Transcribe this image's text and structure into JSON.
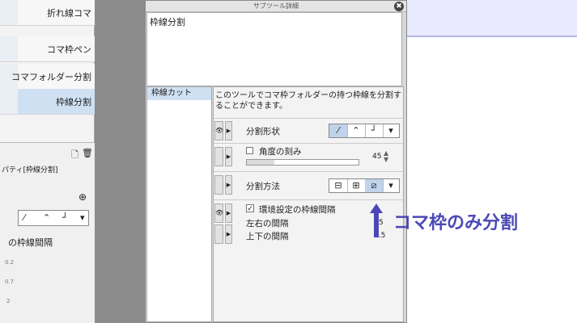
{
  "left_tools": [
    {
      "label": "折れ線コマ"
    },
    {
      "label": "コマ枠ペン"
    },
    {
      "label": "コマフォルダー分割"
    },
    {
      "label": "枠線分割",
      "selected": true
    }
  ],
  "left_small": {
    "prop_label": "パティ[枠線分割]",
    "spacing_label": "の枠線間隔",
    "sizes": [
      "0.2",
      "0.7",
      "2"
    ]
  },
  "dialog": {
    "title": "サブツール詳細",
    "close": "✖",
    "tool_name": "枠線分割",
    "category": "枠線カット",
    "description": "このツールでコマ枠フォルダーの持つ枠線を分割することができます。",
    "rows": {
      "split_shape": {
        "label": "分割形状"
      },
      "angle": {
        "label": "角度の刻み",
        "value": "45"
      },
      "split_method": {
        "label": "分割方法"
      },
      "env_spacing": {
        "label": "環境設定の枠線間隔"
      },
      "lr_spacing": {
        "label": "左右の間隔",
        "value": "5"
      },
      "tb_spacing": {
        "label": "上下の間隔",
        "value": "3.5"
      }
    }
  },
  "annotation": {
    "text": "コマ枠のみ分割",
    "color": "#4b48b6"
  },
  "colors": {
    "selection": "#cfe0f3",
    "gray": "#8c8c8c"
  }
}
